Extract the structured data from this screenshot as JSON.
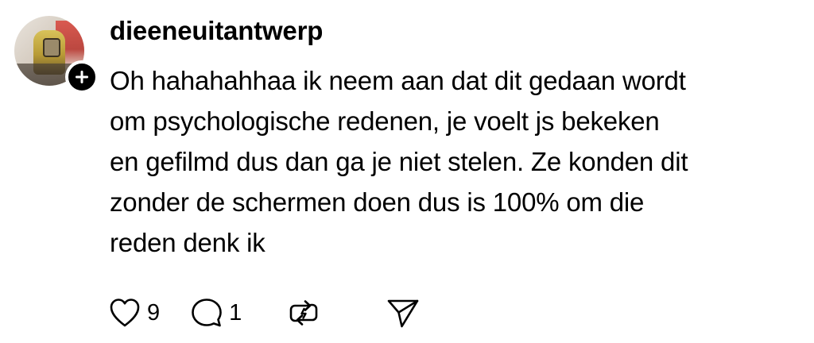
{
  "comment": {
    "username": "dieeneuitantwerp",
    "text_lines": [
      "Oh hahahahhaa ik neem aan dat dit gedaan wordt",
      "om psychologische redenen, je voelt js bekeken",
      "en gefilmd dus dan ga je niet stelen. Ze konden dit",
      "zonder de schermen doen dus is 100% om die",
      "reden denk ik"
    ],
    "avatar_icon": "profile-photo",
    "follow_icon": "plus-icon"
  },
  "actions": {
    "like": {
      "icon": "heart-icon",
      "count": "9"
    },
    "reply": {
      "icon": "speech-bubble-icon",
      "count": "1"
    },
    "repost": {
      "icon": "repost-icon"
    },
    "share": {
      "icon": "send-icon"
    }
  },
  "colors": {
    "text": "#000000",
    "background": "#ffffff",
    "badge": "#000000"
  }
}
